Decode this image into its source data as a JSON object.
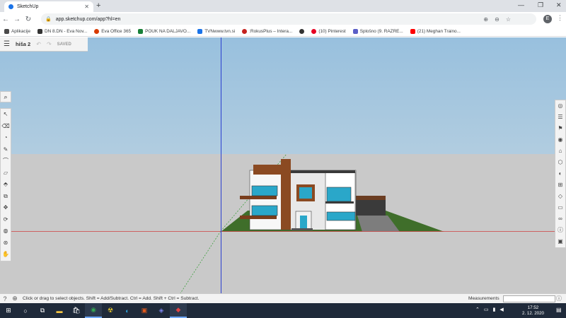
{
  "browser": {
    "tab_title": "SketchUp",
    "tab_close": "✕",
    "new_tab": "+",
    "url": "app.sketchup.com/app?hl=en",
    "profile_initial": "E",
    "window_controls": [
      "—",
      "❐",
      "✕"
    ],
    "bookmarks": [
      {
        "label": "Aplikacije",
        "color": "#4a4a4a"
      },
      {
        "label": "DN 8.DN - Eva Nov...",
        "color": "#333333"
      },
      {
        "label": "Eva Office 365",
        "color": "#d83b01"
      },
      {
        "label": "POUK NA DALJAVO...",
        "color": "#188038"
      },
      {
        "label": "TVNwww.tvn.si",
        "color": "#1a73e8"
      },
      {
        "label": ":RokusPlus – Intera...",
        "color": "#c5221f"
      },
      {
        "label": "",
        "color": "#333333"
      },
      {
        "label": "(10) Pinterest",
        "color": "#e60023"
      },
      {
        "label": "Splošno (9. RAZRE...",
        "color": "#5b5fc7"
      },
      {
        "label": "(21) Meghan Traino...",
        "color": "#ff0000"
      }
    ]
  },
  "sketchup": {
    "file_name": "hiša 2",
    "saved_label": "SAVED",
    "status_message": "Click or drag to select objects. Shift = Add/Subtract. Ctrl = Add. Shift + Ctrl = Subtract.",
    "measurements_label": "Measurements",
    "measurements_value": "",
    "left_tools": [
      "select-tool",
      "eraser-tool",
      "paint-bucket-tool",
      "pencil-tool",
      "arc-tool",
      "rectangle-tool",
      "push-pull-tool",
      "offset-tool",
      "move-tool",
      "rotate-tool",
      "scale-tool",
      "tape-measure-tool",
      "orbit-tool"
    ],
    "right_tools": [
      "entity-info",
      "instructor",
      "components",
      "materials",
      "styles",
      "layers",
      "scenes",
      "outliner",
      "display",
      "shadows",
      "solar-north",
      "help",
      "extension"
    ]
  },
  "taskbar": {
    "time": "17:52",
    "date": "2. 12. 2020",
    "apps": [
      "start",
      "search",
      "task-view",
      "file-explorer",
      "store",
      "chrome",
      "radioactive",
      "edge",
      "office",
      "teams",
      "sketchup"
    ]
  }
}
